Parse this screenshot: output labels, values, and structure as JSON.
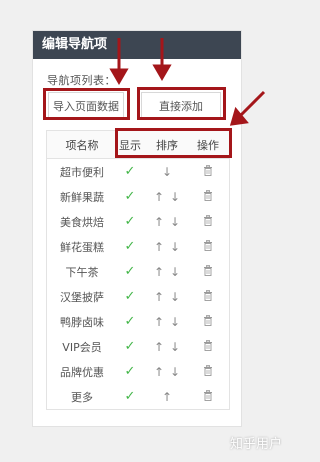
{
  "panel": {
    "title": "编辑导航项",
    "list_label": "导航项列表：",
    "import_button": "导入页面数据",
    "add_button": "直接添加"
  },
  "table": {
    "headers": [
      "项名称",
      "显示",
      "排序",
      "操作"
    ],
    "rows": [
      {
        "name": "超市便利",
        "shown": true,
        "sort": [
          "down"
        ]
      },
      {
        "name": "新鲜果蔬",
        "shown": true,
        "sort": [
          "up",
          "down"
        ]
      },
      {
        "name": "美食烘焙",
        "shown": true,
        "sort": [
          "up",
          "down"
        ]
      },
      {
        "name": "鲜花蛋糕",
        "shown": true,
        "sort": [
          "up",
          "down"
        ]
      },
      {
        "name": "下午茶",
        "shown": true,
        "sort": [
          "up",
          "down"
        ]
      },
      {
        "name": "汉堡披萨",
        "shown": true,
        "sort": [
          "up",
          "down"
        ]
      },
      {
        "name": "鸭脖卤味",
        "shown": true,
        "sort": [
          "up",
          "down"
        ]
      },
      {
        "name": "VIP会员",
        "shown": true,
        "sort": [
          "up",
          "down"
        ]
      },
      {
        "name": "品牌优惠",
        "shown": true,
        "sort": [
          "up",
          "down"
        ]
      },
      {
        "name": "更多",
        "shown": true,
        "sort": [
          "up"
        ]
      }
    ]
  },
  "icons": {
    "check": "check-icon",
    "up": "arrow-up-icon",
    "down": "arrow-down-icon",
    "delete": "trash-icon"
  },
  "colors": {
    "header_bg": "#3d4652",
    "check": "#43b649",
    "annotation": "#a4161a"
  },
  "watermark": "知乎用户"
}
